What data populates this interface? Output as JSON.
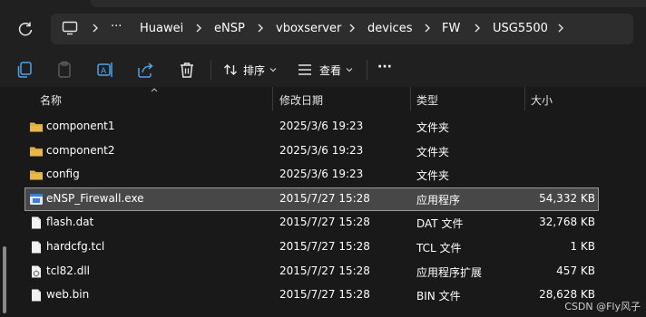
{
  "breadcrumbs": [
    "Huawei",
    "eNSP",
    "vboxserver",
    "devices",
    "FW",
    "USG5500"
  ],
  "overflow": "···",
  "toolbar": {
    "sort_label": "排序",
    "view_label": "查看",
    "more_label": "···"
  },
  "columns": {
    "name": "名称",
    "date": "修改日期",
    "type": "类型",
    "size": "大小"
  },
  "files": [
    {
      "name": "component1",
      "date": "2025/3/6 19:23",
      "type": "文件夹",
      "size": "",
      "icon": "folder-icon"
    },
    {
      "name": "component2",
      "date": "2025/3/6 19:23",
      "type": "文件夹",
      "size": "",
      "icon": "folder-icon"
    },
    {
      "name": "config",
      "date": "2025/3/6 19:23",
      "type": "文件夹",
      "size": "",
      "icon": "folder-icon"
    },
    {
      "name": "eNSP_Firewall.exe",
      "date": "2015/7/27 15:28",
      "type": "应用程序",
      "size": "54,332 KB",
      "icon": "exe-icon"
    },
    {
      "name": "flash.dat",
      "date": "2015/7/27 15:28",
      "type": "DAT 文件",
      "size": "32,768 KB",
      "icon": "file-icon"
    },
    {
      "name": "hardcfg.tcl",
      "date": "2015/7/27 15:28",
      "type": "TCL 文件",
      "size": "1 KB",
      "icon": "file-icon"
    },
    {
      "name": "tcl82.dll",
      "date": "2015/7/27 15:28",
      "type": "应用程序扩展",
      "size": "457 KB",
      "icon": "dll-icon"
    },
    {
      "name": "web.bin",
      "date": "2015/7/27 15:28",
      "type": "BIN 文件",
      "size": "28,628 KB",
      "icon": "file-icon"
    }
  ],
  "watermark": "CSDN @Fly风子",
  "colors": {
    "folder": "#e8b94a",
    "selection": "#474747",
    "background": "#191919"
  }
}
